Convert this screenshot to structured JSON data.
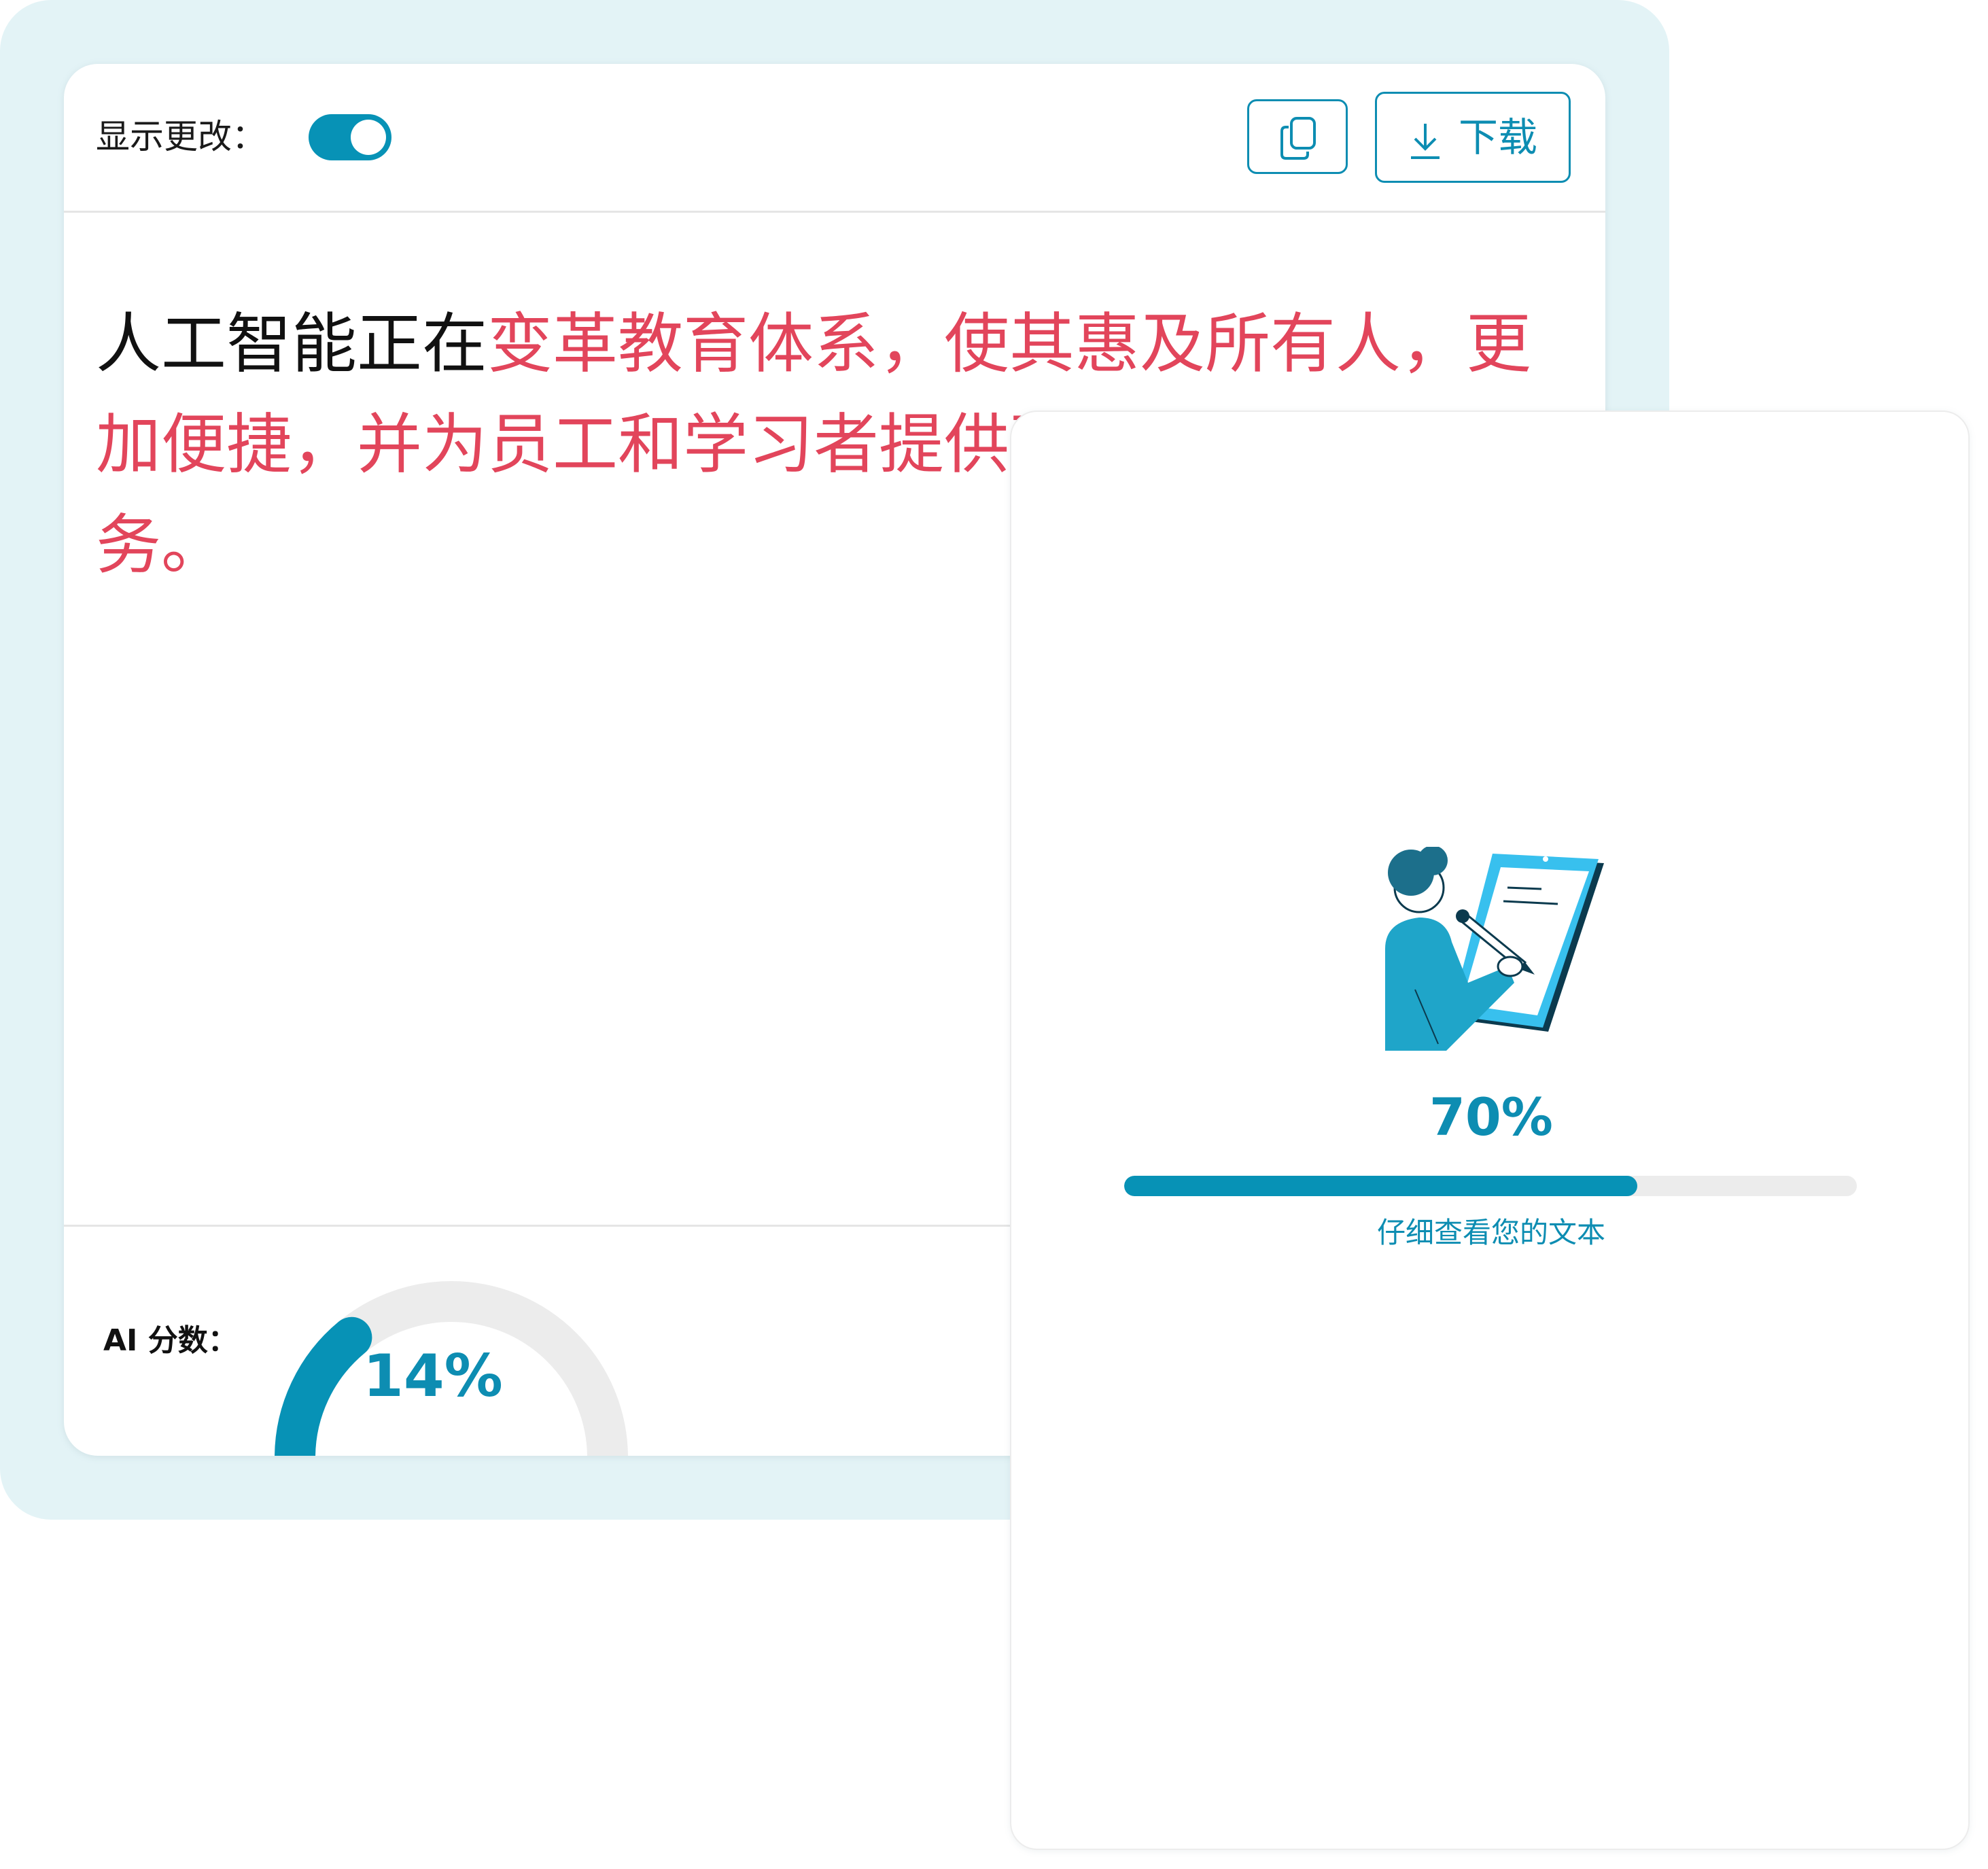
{
  "editor": {
    "show_changes_label": "显示更改：",
    "show_changes_enabled": true,
    "copy_icon": "copy-icon",
    "download_icon": "download-icon",
    "download_label": "下载",
    "text_unchanged": "人工智能正在",
    "text_changed": "变革教育体系，使其惠及所有人，更加便捷，并为员工和学习者提供更加个性化的服务。",
    "ai_score_label": "AI 分数：",
    "ai_score_value": "14%",
    "ai_score_fraction": 0.14
  },
  "progress": {
    "illustration": "person-writing-on-tablet",
    "percent_label": "70%",
    "percent_value": 0.7,
    "caption": "仔细查看您的文本"
  },
  "colors": {
    "accent": "#0792b6",
    "changed_text": "#e2455b",
    "backdrop": "#e3f3f6",
    "track": "#ececec"
  }
}
